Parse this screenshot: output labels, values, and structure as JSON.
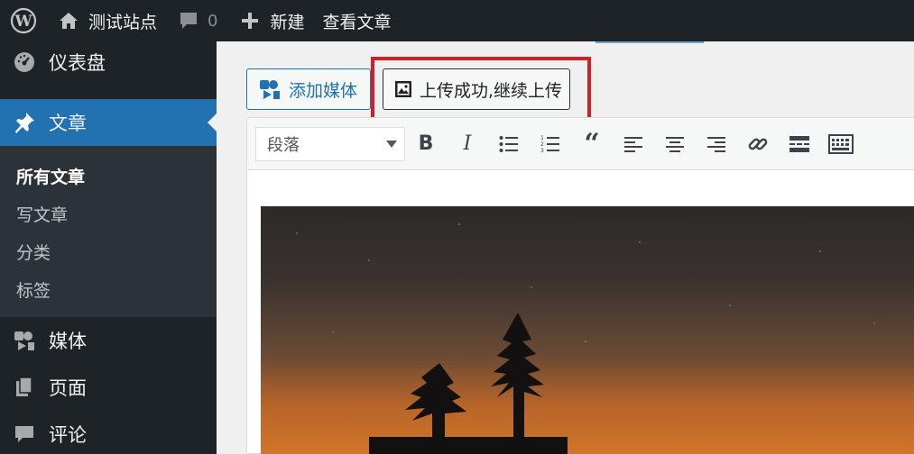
{
  "adminbar": {
    "site_name": "测试站点",
    "comment_count": "0",
    "new_label": "新建",
    "view_label": "查看文章"
  },
  "sidebar": {
    "dashboard": "仪表盘",
    "posts": "文章",
    "submenu": [
      "所有文章",
      "写文章",
      "分类",
      "标签"
    ],
    "media": "媒体",
    "pages": "页面",
    "comments": "评论"
  },
  "editor": {
    "add_media_label": "添加媒体",
    "upload_label": "上传成功,继续上传",
    "format_value": "段落",
    "toolbar_icons": [
      "bold-icon",
      "italic-icon",
      "bullet-list-icon",
      "numbered-list-icon",
      "blockquote-icon",
      "align-left-icon",
      "align-center-icon",
      "align-right-icon",
      "link-icon",
      "read-more-icon",
      "toolbar-toggle-icon"
    ]
  },
  "colors": {
    "adminbar_bg": "#1d2327",
    "accent": "#2271b1",
    "highlight": "#d32027"
  }
}
